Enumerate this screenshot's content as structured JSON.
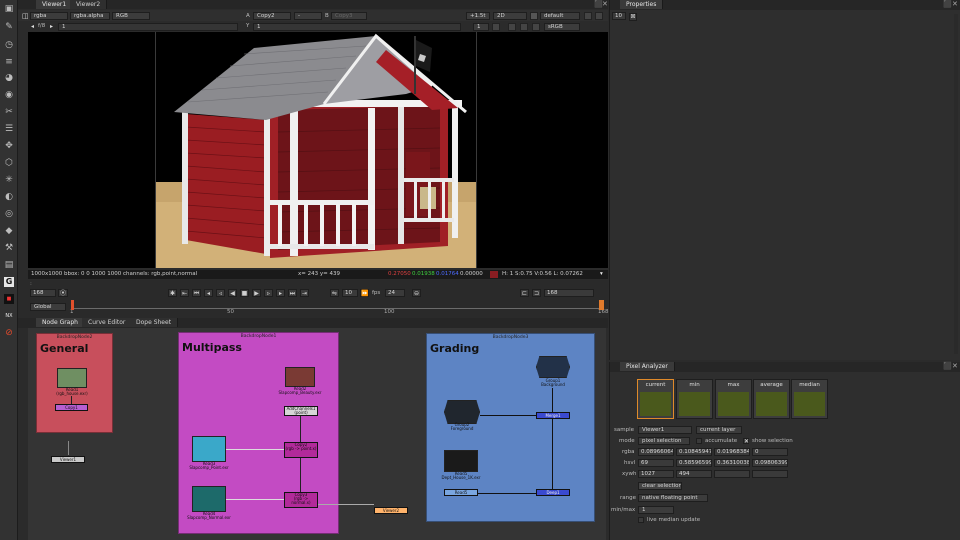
{
  "toolbar_icons": [
    "viewer-icon",
    "paint-icon",
    "time-icon",
    "channel-icon",
    "color-icon",
    "filter-icon",
    "keyer-icon",
    "merge-icon",
    "transform-icon",
    "3d-icon",
    "particles-icon",
    "deep-icon",
    "views-icon",
    "metadata-icon",
    "toolsets-icon",
    "other-icon",
    "furnace-icon",
    "ofx-icon",
    "g-logo-icon",
    "foundry-icon",
    "nukex-icon",
    "help-icon",
    "play-icon"
  ],
  "viewer_tabs": [
    "Viewer1",
    "Viewer2"
  ],
  "viewer_top": {
    "channels": "rgba",
    "layer": "rgba.alpha",
    "display": "RGB",
    "a_label": "A",
    "a_input": "Copy2",
    "dash": "-",
    "b_label": "B",
    "b_input": "Copy3",
    "zoom": "+1.5t",
    "mode": "2D",
    "lut": "default",
    "fstop_label": "f/8",
    "frame_a": "1",
    "y_label": "Y",
    "y_value": "1",
    "frame_b": "1",
    "colorspace": "sRGB"
  },
  "viewer_status": {
    "info": "1000x1000  bbox: 0 0 1000 1000  channels: rgb,point,normal",
    "xy": "x= 243 y= 439",
    "r": "0.27050",
    "g": "0.01938",
    "b": "0.01764",
    "a": "0.00000",
    "hsv": "H: 1 S:0.75 V:0.56  L: 0.07262"
  },
  "timeline": {
    "frame": "168",
    "view": "Global",
    "ticks": [
      "1",
      "50",
      "100",
      "168"
    ],
    "current_marker": "168",
    "play_frame": "10",
    "fps_label": "fps",
    "fps": "24",
    "colon": ":"
  },
  "nodegraph_tabs": [
    "Node Graph",
    "Curve Editor",
    "Dope Sheet"
  ],
  "backdrops": {
    "general": {
      "name": "BackdropNode2",
      "title": "General",
      "color": "#c84f5c"
    },
    "multipass": {
      "name": "BackdropNode1",
      "title": "Multipass",
      "color": "#c34bc3"
    },
    "grading": {
      "name": "BackdropNode3",
      "title": "Grading",
      "color": "#5d84c4"
    }
  },
  "nodes": {
    "read1": "Read1",
    "read1_file": "(rgb_house.exr)",
    "copy1": "Copy1",
    "viewer1": "Viewer1",
    "read2": "Read2",
    "read2_file": "Slapcomp_Beauty.exr",
    "addchannels": "AddChannels1",
    "addchannels_sub": "(point)",
    "read3": "Read3",
    "read3_file": "Slapcomp_Point.exr",
    "copy2": "Copy2",
    "copy2_sub": "(rgb -> point.x)",
    "read4": "Read4",
    "read4_file": "Slapcomp_Normal.exr",
    "copy3": "Copy3",
    "copy3_sub": "(rgb -> normal.x)",
    "viewer2": "Viewer2",
    "group1": "Group1",
    "group1_sub": "Background",
    "group2": "Group2",
    "group2_sub": "Foreground",
    "read5": "Read5",
    "read5_file": "Dept_House_1K.exr",
    "merge_node": "Merge1",
    "deep_node": "Deep1"
  },
  "properties": {
    "title": "Properties",
    "count": "10"
  },
  "pixel_analyzer": {
    "title": "Pixel Analyzer",
    "swatches": [
      "current",
      "min",
      "max",
      "average",
      "median"
    ],
    "swatch_color": "#4a591c",
    "sample_label": "sample",
    "sample_value": "Viewer1",
    "layer_value": "current layer",
    "mode_label": "mode",
    "mode_value": "pixel selection",
    "accumulate": "accumulate",
    "show_selection": "show selection",
    "rgba_label": "rgba",
    "rgba": [
      "0.08966064",
      "0.10845947",
      "0.01968384",
      "0"
    ],
    "hsvl_label": "hsvl",
    "hsvl": [
      "69",
      "0.58596599",
      "0.36310038",
      "0.09806399"
    ],
    "xywh_label": "xywh",
    "xywh": [
      "1027",
      "494",
      "",
      ""
    ],
    "clear_button": "clear selection",
    "range_label": "range",
    "range_value": "native floating point",
    "minmax_label": "min/max",
    "minmax_value": "1",
    "live_median": "live median update"
  }
}
